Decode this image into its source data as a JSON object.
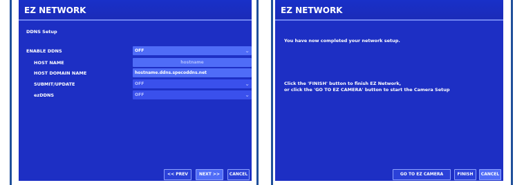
{
  "left": {
    "title": "EZ NETWORK",
    "subtitle": "DDNS Setup",
    "rows": [
      {
        "label": "ENABLE DDNS",
        "value": "OFF"
      },
      {
        "label": "HOST NAME",
        "value": "hostname"
      },
      {
        "label": "HOST DOMAIN NAME",
        "value": "hostname.ddns.specoddns.net"
      },
      {
        "label": "SUBMIT/UPDATE",
        "value": "OFF"
      },
      {
        "label": "ezDDNS",
        "value": "OFF"
      }
    ],
    "buttons": {
      "prev": "<< PREV",
      "next": "NEXT >>",
      "cancel": "CANCEL"
    }
  },
  "right": {
    "title": "EZ NETWORK",
    "message1": "You have now completed your network setup.",
    "message2": "Click the 'FINISH' button to finish EZ Network,",
    "message3": "or click the 'GO TO EZ CAMERA' button to start the Camera Setup",
    "buttons": {
      "go_to_camera": "GO TO EZ CAMERA",
      "finish": "FINISH",
      "cancel": "CANCEL"
    }
  },
  "icons": {
    "dropdown": "chevron-down-icon"
  },
  "colors": {
    "screen_bg": "#1d2fc4",
    "field_active": "#4f6cf7",
    "border": "#1f4f9a"
  }
}
